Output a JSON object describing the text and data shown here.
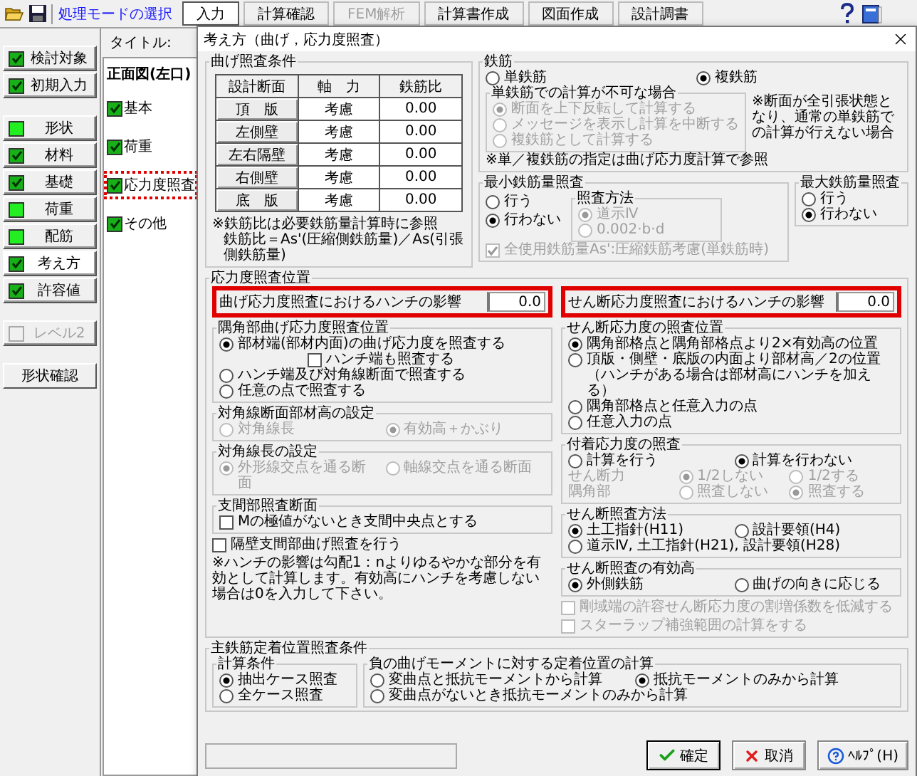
{
  "toolbar": {
    "mode_label": "処理モードの選択",
    "modes": [
      {
        "label": "入力",
        "selected": true,
        "disabled": false
      },
      {
        "label": "計算確認",
        "selected": false,
        "disabled": false
      },
      {
        "label": "FEM解析",
        "selected": false,
        "disabled": true
      },
      {
        "label": "計算書作成",
        "selected": false,
        "disabled": false
      },
      {
        "label": "図面作成",
        "selected": false,
        "disabled": false
      },
      {
        "label": "設計調書",
        "selected": false,
        "disabled": false
      }
    ]
  },
  "side_menu": {
    "groups": [
      [
        {
          "label": "検討対象",
          "checked": true,
          "selected": false,
          "disabled": false
        },
        {
          "label": "初期入力",
          "checked": true,
          "selected": false,
          "disabled": false
        }
      ],
      [
        {
          "label": "形状",
          "checked": false,
          "selected": false,
          "disabled": false
        },
        {
          "label": "材料",
          "checked": true,
          "selected": false,
          "disabled": false
        },
        {
          "label": "基礎",
          "checked": true,
          "selected": false,
          "disabled": false
        },
        {
          "label": "荷重",
          "checked": false,
          "selected": false,
          "disabled": false
        },
        {
          "label": "配筋",
          "checked": false,
          "selected": false,
          "disabled": false
        },
        {
          "label": "考え方",
          "checked": true,
          "selected": true,
          "disabled": false
        },
        {
          "label": "許容値",
          "checked": true,
          "selected": false,
          "disabled": false
        }
      ],
      [
        {
          "label": "レベル2",
          "checked": false,
          "selected": false,
          "disabled": true
        }
      ]
    ],
    "action": "形状確認"
  },
  "title_label": "タイトル:",
  "tree": {
    "root": "正面図(左口)",
    "items": [
      {
        "label": "基本",
        "checked": true,
        "highlighted": false
      },
      {
        "label": "荷重",
        "checked": true,
        "highlighted": false
      },
      {
        "label": "応力度照査",
        "checked": true,
        "highlighted": true
      },
      {
        "label": "その他",
        "checked": true,
        "highlighted": false
      }
    ]
  },
  "dialog": {
    "title": "考え方（曲げ，応力度照査）",
    "bending": {
      "title": "曲げ照査条件",
      "columns": [
        "設計断面",
        "軸　力",
        "鉄筋比"
      ],
      "rows": [
        {
          "section": "頂　版",
          "axial": "考慮",
          "ratio": "0.00"
        },
        {
          "section": "左側壁",
          "axial": "考慮",
          "ratio": "0.00"
        },
        {
          "section": "左右隔壁",
          "axial": "考慮",
          "ratio": "0.00"
        },
        {
          "section": "右側壁",
          "axial": "考慮",
          "ratio": "0.00"
        },
        {
          "section": "底　版",
          "axial": "考慮",
          "ratio": "0.00"
        }
      ],
      "notes": [
        "※鉄筋比は必要鉄筋量計算時に参照",
        "鉄筋比＝As'(圧縮側鉄筋量)／As(引張側鉄筋量)"
      ]
    },
    "rebar": {
      "title": "鉄筋",
      "options": [
        {
          "kind": "radio",
          "label": "単鉄筋",
          "selected": false,
          "disabled": false
        },
        {
          "kind": "radio",
          "label": "複鉄筋",
          "selected": true,
          "disabled": false
        }
      ],
      "fallback": {
        "title": "単鉄筋での計算が不可な場合",
        "rows": [
          [
            {
              "kind": "radio",
              "label": "断面を上下反転して計算する",
              "selected": true,
              "disabled": true
            }
          ],
          [
            {
              "kind": "radio",
              "label": "メッセージを表示し計算を中断する",
              "selected": false,
              "disabled": true
            }
          ],
          [
            {
              "kind": "radio",
              "label": "複鉄筋として計算する",
              "selected": false,
              "disabled": true
            }
          ]
        ]
      },
      "side_note": "※断面が全引張状態となり、通常の単鉄筋での計算が行えない場合",
      "note": "※単／複鉄筋の指定は曲げ応力度計算で参照"
    },
    "min_rebar": {
      "title": "最小鉄筋量照査",
      "options": [
        {
          "kind": "radio",
          "label": "行う",
          "selected": false,
          "disabled": false
        },
        {
          "kind": "radio",
          "label": "行わない",
          "selected": true,
          "disabled": false
        }
      ],
      "method": {
        "title": "照査方法",
        "rows": [
          [
            {
              "kind": "radio",
              "label": "道示Ⅳ",
              "selected": true,
              "disabled": true
            }
          ],
          [
            {
              "kind": "radio",
              "label": "0.002·b·d",
              "selected": false,
              "disabled": true
            }
          ]
        ]
      },
      "checkbox": {
        "kind": "checkbox",
        "label": "全使用鉄筋量As':圧縮鉄筋考慮(単鉄筋時)",
        "checked": true,
        "disabled": true
      }
    },
    "max_rebar": {
      "title": "最大鉄筋量照査",
      "rows": [
        [
          {
            "kind": "radio",
            "label": "行う",
            "selected": false,
            "disabled": false
          }
        ],
        [
          {
            "kind": "radio",
            "label": "行わない",
            "selected": true,
            "disabled": false
          }
        ]
      ]
    },
    "stress": {
      "title": "応力度照査位置",
      "columns": [
        {
          "haunch": {
            "label": "曲げ応力度照査におけるハンチの影響",
            "value": "0.0",
            "highlighted": true
          },
          "groups": [
            {
              "title": "隅角部曲げ応力度照査位置",
              "rows": [
                [
                  {
                    "kind": "radio",
                    "label": "部材端(部材内面)の曲げ応力度を照査する",
                    "selected": true,
                    "disabled": false
                  }
                ],
                [
                  {
                    "kind": "subcheckbox",
                    "label": "ハンチ端も照査する",
                    "checked": false,
                    "disabled": false
                  }
                ],
                [
                  {
                    "kind": "radio",
                    "label": "ハンチ端及び対角線断面で照査する",
                    "selected": false,
                    "disabled": false
                  }
                ],
                [
                  {
                    "kind": "radio",
                    "label": "任意の点で照査する",
                    "selected": false,
                    "disabled": false
                  }
                ]
              ]
            },
            {
              "title": "対角線断面部材高の設定",
              "rows": [
                [
                  {
                    "kind": "radio",
                    "label": "対角線長",
                    "selected": false,
                    "disabled": true
                  },
                  {
                    "kind": "radio",
                    "label": "有効高＋かぶり",
                    "selected": true,
                    "disabled": true
                  }
                ]
              ]
            },
            {
              "title": "対角線長の設定",
              "rows": [
                [
                  {
                    "kind": "radio",
                    "label": "外形線交点を通る断面",
                    "selected": true,
                    "disabled": true
                  },
                  {
                    "kind": "radio",
                    "label": "軸線交点を通る断面",
                    "selected": false,
                    "disabled": true
                  }
                ]
              ]
            },
            {
              "title": "支間部照査断面",
              "rows": [
                [
                  {
                    "kind": "checkbox",
                    "label": "Mの極値がないとき支間中央点とする",
                    "checked": false,
                    "disabled": false
                  }
                ]
              ]
            }
          ],
          "extras": [
            [
              {
                "kind": "checkbox",
                "label": "隔壁支間部曲げ照査を行う",
                "checked": false,
                "disabled": false
              }
            ],
            [
              {
                "kind": "note",
                "label": "※ハンチの影響は勾配1：nよりゆるやかな部分を有効として計算します。有効高にハンチを考慮しない場合は0を入力して下さい。"
              }
            ]
          ]
        },
        {
          "haunch": {
            "label": "せん断応力度照査におけるハンチの影響",
            "value": "0.0",
            "highlighted": true
          },
          "groups": [
            {
              "title": "せん断応力度の照査位置",
              "rows": [
                [
                  {
                    "kind": "radio",
                    "label": "隅角部格点と隅角部格点より2×有効高の位置",
                    "selected": true,
                    "disabled": false
                  }
                ],
                [
                  {
                    "kind": "radio",
                    "label": "頂版・側壁・底版の内面より部材高／2の位置（ハンチがある場合は部材高にハンチを加える）",
                    "selected": false,
                    "disabled": false
                  }
                ],
                [
                  {
                    "kind": "radio",
                    "label": "隅角部格点と任意入力の点",
                    "selected": false,
                    "disabled": false
                  }
                ],
                [
                  {
                    "kind": "radio",
                    "label": "任意入力の点",
                    "selected": false,
                    "disabled": false
                  }
                ]
              ]
            },
            {
              "title": "付着応力度の照査",
              "rows": [
                [
                  {
                    "kind": "radio",
                    "label": "計算を行う",
                    "selected": false,
                    "disabled": false
                  },
                  {
                    "kind": "radio",
                    "label": "計算を行わない",
                    "selected": true,
                    "disabled": false
                  }
                ],
                [
                  {
                    "kind": "label",
                    "label": "せん断力",
                    "disabled": true
                  },
                  {
                    "kind": "radio",
                    "label": "1/2しない",
                    "selected": true,
                    "disabled": true
                  },
                  {
                    "kind": "radio",
                    "label": "1/2する",
                    "selected": false,
                    "disabled": true
                  }
                ],
                [
                  {
                    "kind": "label",
                    "label": "隅角部",
                    "disabled": true
                  },
                  {
                    "kind": "radio",
                    "label": "照査しない",
                    "selected": false,
                    "disabled": true
                  },
                  {
                    "kind": "radio",
                    "label": "照査する",
                    "selected": true,
                    "disabled": true
                  }
                ]
              ]
            },
            {
              "title": "せん断照査方法",
              "rows": [
                [
                  {
                    "kind": "radio",
                    "label": "土工指針(H11)",
                    "selected": true,
                    "disabled": false
                  },
                  {
                    "kind": "radio",
                    "label": "設計要領(H4)",
                    "selected": false,
                    "disabled": false
                  }
                ],
                [
                  {
                    "kind": "radio",
                    "label": "道示Ⅳ, 土工指針(H21), 設計要領(H28)",
                    "selected": false,
                    "disabled": false
                  }
                ]
              ]
            },
            {
              "title": "せん断照査の有効高",
              "rows": [
                [
                  {
                    "kind": "radio",
                    "label": "外側鉄筋",
                    "selected": true,
                    "disabled": false
                  },
                  {
                    "kind": "radio",
                    "label": "曲げの向きに応じる",
                    "selected": false,
                    "disabled": false
                  }
                ]
              ]
            }
          ],
          "extras": [
            [
              {
                "kind": "checkbox",
                "label": "剛域端の許容せん断応力度の割増係数を低減する",
                "checked": false,
                "disabled": true
              }
            ],
            [
              {
                "kind": "checkbox",
                "label": "スターラップ補強範囲の計算をする",
                "checked": false,
                "disabled": true
              }
            ]
          ]
        }
      ]
    },
    "anchorage": {
      "title": "主鉄筋定着位置照査条件",
      "groups": [
        {
          "title": "計算条件",
          "rows": [
            [
              {
                "kind": "radio",
                "label": "抽出ケース照査",
                "selected": true,
                "disabled": false
              }
            ],
            [
              {
                "kind": "radio",
                "label": "全ケース照査",
                "selected": false,
                "disabled": false
              }
            ]
          ]
        },
        {
          "title": "負の曲げモーメントに対する定着位置の計算",
          "rows": [
            [
              {
                "kind": "radio",
                "label": "変曲点と抵抗モーメントから計算",
                "selected": false,
                "disabled": false
              },
              {
                "kind": "radio",
                "label": "抵抗モーメントのみから計算",
                "selected": true,
                "disabled": false
              }
            ],
            [
              {
                "kind": "radio",
                "label": "変曲点がないとき抵抗モーメントのみから計算",
                "selected": false,
                "disabled": false
              }
            ]
          ]
        }
      ]
    },
    "buttons": [
      {
        "kind": "ok",
        "label": "確定"
      },
      {
        "kind": "cancel",
        "label": "取消"
      },
      {
        "kind": "help",
        "label": "ﾍﾙﾌﾟ(H)"
      }
    ]
  }
}
